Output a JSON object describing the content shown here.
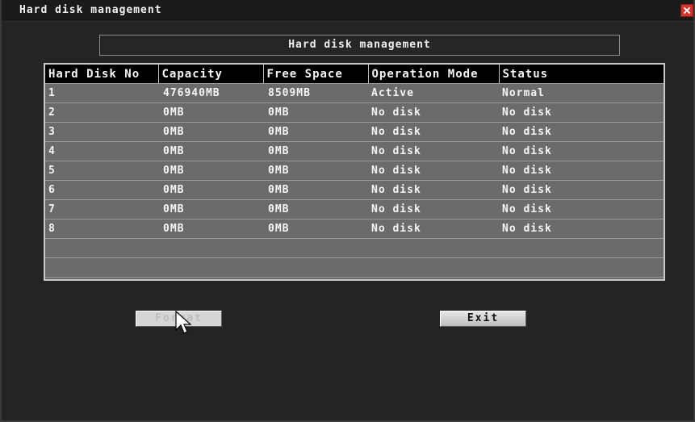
{
  "window": {
    "title": "Hard disk management",
    "close_icon": "close-icon",
    "accent_close": "#d8342c"
  },
  "panel": {
    "heading": "Hard disk management"
  },
  "table": {
    "columns": [
      "Hard Disk No",
      "Capacity",
      "Free Space",
      "Operation Mode",
      "Status"
    ],
    "rows": [
      {
        "no": "1",
        "capacity": "476940MB",
        "free": "8509MB",
        "mode": "Active",
        "status": "Normal"
      },
      {
        "no": "2",
        "capacity": "0MB",
        "free": "0MB",
        "mode": "No disk",
        "status": "No disk"
      },
      {
        "no": "3",
        "capacity": "0MB",
        "free": "0MB",
        "mode": "No disk",
        "status": "No disk"
      },
      {
        "no": "4",
        "capacity": "0MB",
        "free": "0MB",
        "mode": "No disk",
        "status": "No disk"
      },
      {
        "no": "5",
        "capacity": "0MB",
        "free": "0MB",
        "mode": "No disk",
        "status": "No disk"
      },
      {
        "no": "6",
        "capacity": "0MB",
        "free": "0MB",
        "mode": "No disk",
        "status": "No disk"
      },
      {
        "no": "7",
        "capacity": "0MB",
        "free": "0MB",
        "mode": "No disk",
        "status": "No disk"
      },
      {
        "no": "8",
        "capacity": "0MB",
        "free": "0MB",
        "mode": "No disk",
        "status": "No disk"
      },
      {
        "no": "",
        "capacity": "",
        "free": "",
        "mode": "",
        "status": ""
      },
      {
        "no": "",
        "capacity": "",
        "free": "",
        "mode": "",
        "status": ""
      }
    ]
  },
  "buttons": {
    "format_label": "Format",
    "exit_label": "Exit"
  },
  "cursor": {
    "icon": "mouse-pointer-icon"
  }
}
